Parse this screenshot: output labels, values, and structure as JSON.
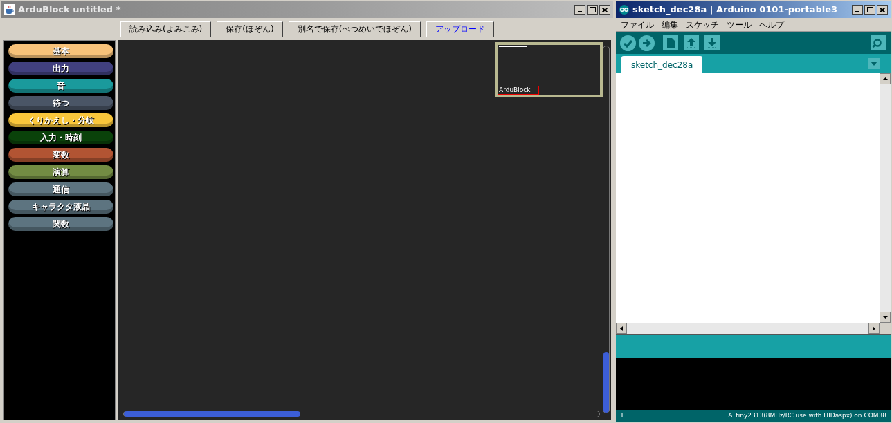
{
  "ardublock_window": {
    "title": "ArduBlock untitled *",
    "toolbar_buttons": [
      {
        "label": "読み込み(よみこみ)",
        "kind": "normal"
      },
      {
        "label": "保存(ほぞん)",
        "kind": "normal"
      },
      {
        "label": "別名で保存(べつめいでほぞん)",
        "kind": "normal"
      },
      {
        "label": "アップロード",
        "kind": "upload"
      }
    ],
    "categories": [
      {
        "label": "基本",
        "color": "#f7c27a"
      },
      {
        "label": "出力",
        "color": "#41407f"
      },
      {
        "label": "音",
        "color": "#1a9a9c"
      },
      {
        "label": "待つ",
        "color": "#4a5566"
      },
      {
        "label": "くりかえし・分岐",
        "color": "#f9c63b"
      },
      {
        "label": "入力・時刻",
        "color": "#0a420a"
      },
      {
        "label": "変数",
        "color": "#b25433"
      },
      {
        "label": "演算",
        "color": "#738c43"
      },
      {
        "label": "通信",
        "color": "#5d7480"
      },
      {
        "label": "キャラクタ液晶",
        "color": "#5d7480"
      },
      {
        "label": "関数",
        "color": "#5d7480"
      }
    ],
    "minimap": {
      "label": "ArduBlock"
    }
  },
  "arduino_window": {
    "title": "sketch_dec28a | Arduino 0101-portable3",
    "menu": [
      "ファイル",
      "編集",
      "スケッチ",
      "ツール",
      "ヘルプ"
    ],
    "tabs": [
      {
        "label": "sketch_dec28a",
        "selected": true
      }
    ],
    "status_bar": {
      "line": "1",
      "board": "ATtiny2313(8MHz/RC use with HIDaspx) on COM38"
    }
  }
}
